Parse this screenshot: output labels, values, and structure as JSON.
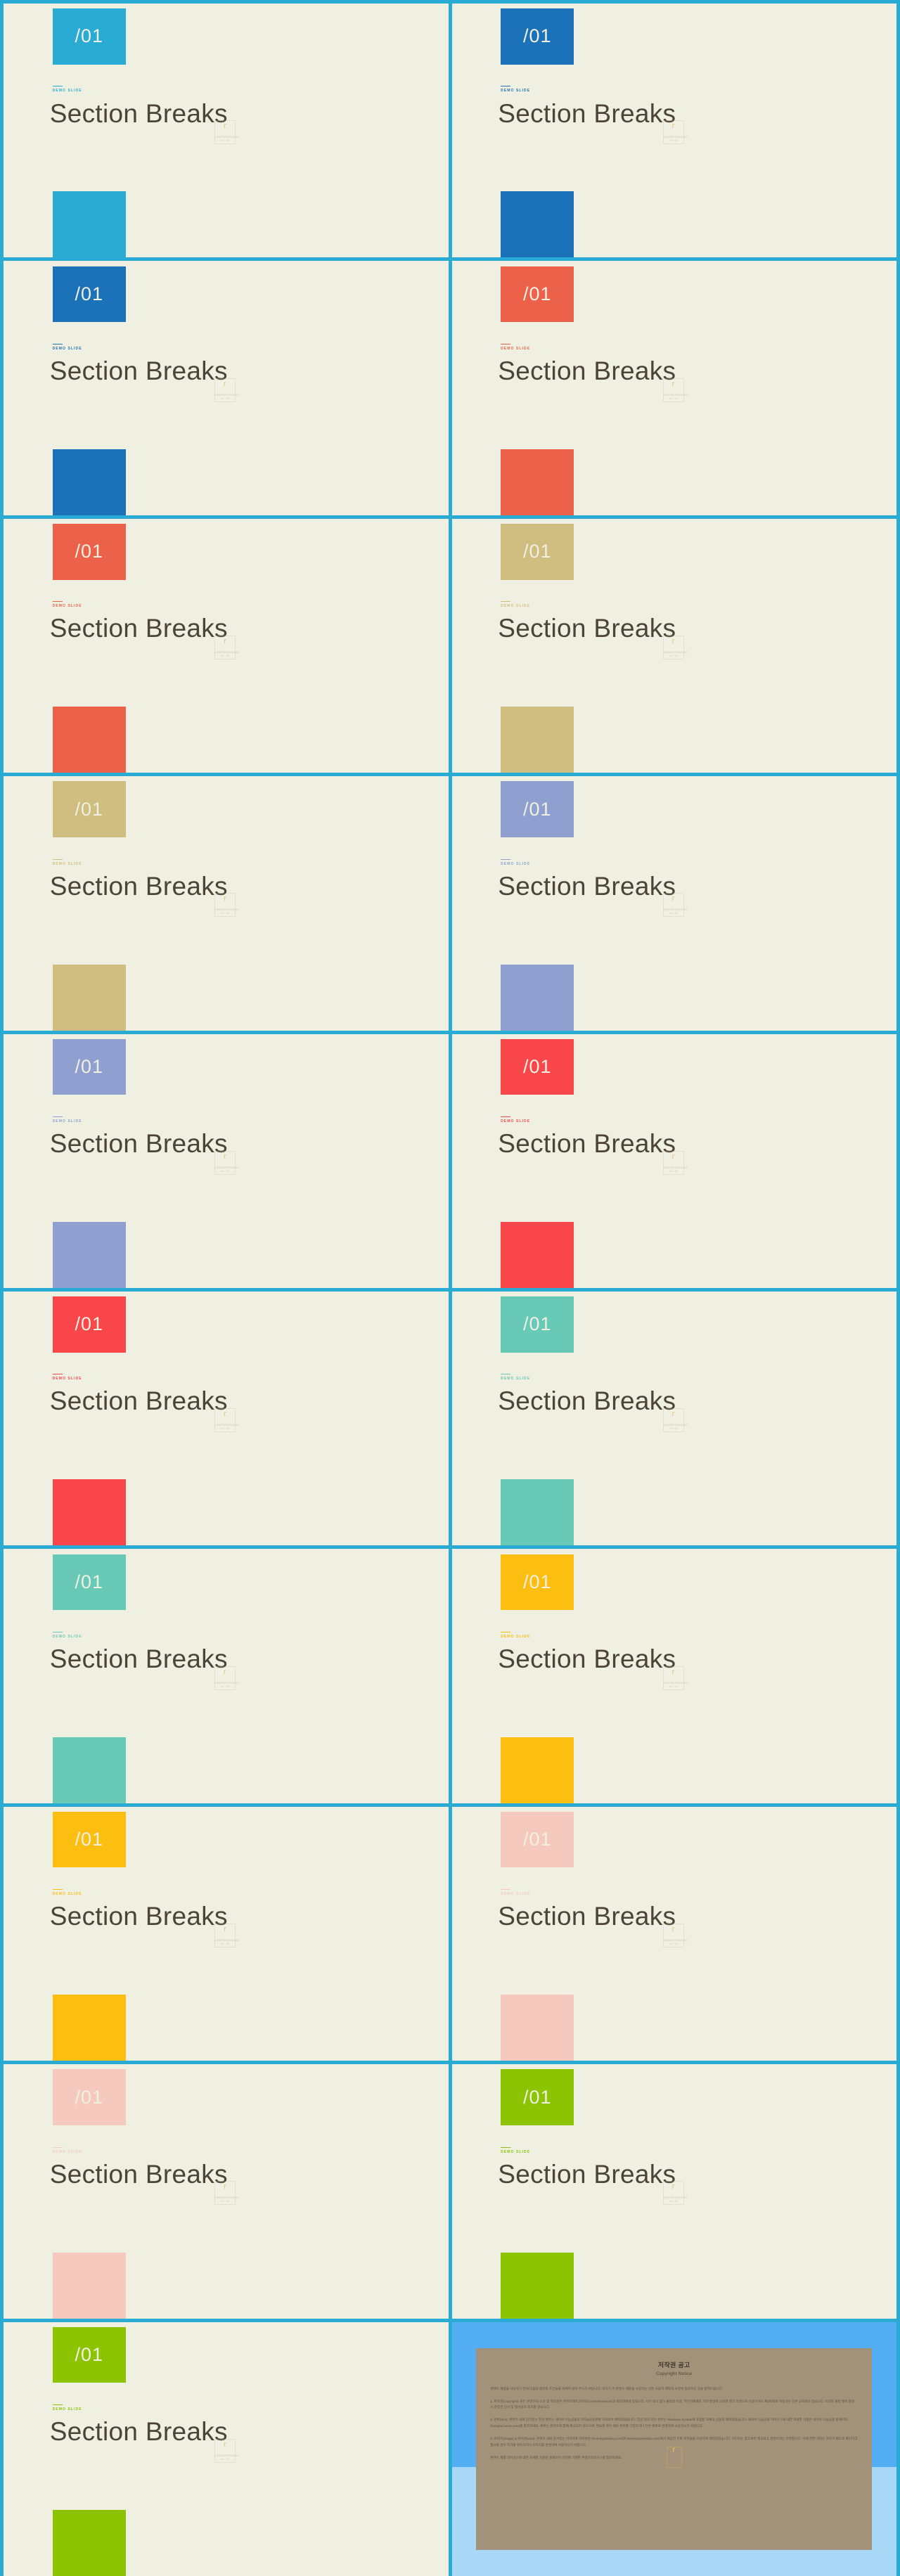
{
  "meta": {
    "canvas_background": "#29ABD4",
    "slide_background": "#EFF0E1",
    "title_color": "#4C4537",
    "divider_color": "#29ABD4"
  },
  "watermark": {
    "glyph": "⸢",
    "line1": "CONTENTSTAKEOUT",
    "line2": "PPT · 제작"
  },
  "slides": [
    {
      "number": "/01",
      "kicker": "DEMO SLIDE",
      "title": "Section Breaks",
      "accent": "#29ABD4"
    },
    {
      "number": "/01",
      "kicker": "DEMO SLIDE",
      "title": "Section Breaks",
      "accent": "#1C72B8"
    },
    {
      "number": "/01",
      "kicker": "DEMO SLIDE",
      "title": "Section Breaks",
      "accent": "#1C72B8"
    },
    {
      "number": "/01",
      "kicker": "DEMO SLIDE",
      "title": "Section Breaks",
      "accent": "#EC6149"
    },
    {
      "number": "/01",
      "kicker": "DEMO SLIDE",
      "title": "Section Breaks",
      "accent": "#EC6149"
    },
    {
      "number": "/01",
      "kicker": "DEMO SLIDE",
      "title": "Section Breaks",
      "accent": "#CFBE7F"
    },
    {
      "number": "/01",
      "kicker": "DEMO SLIDE",
      "title": "Section Breaks",
      "accent": "#CFBE7F"
    },
    {
      "number": "/01",
      "kicker": "DEMO SLIDE",
      "title": "Section Breaks",
      "accent": "#8FA0D0"
    },
    {
      "number": "/01",
      "kicker": "DEMO SLIDE",
      "title": "Section Breaks",
      "accent": "#8FA0D0"
    },
    {
      "number": "/01",
      "kicker": "DEMO SLIDE",
      "title": "Section Breaks",
      "accent": "#F9464B"
    },
    {
      "number": "/01",
      "kicker": "DEMO SLIDE",
      "title": "Section Breaks",
      "accent": "#F9464B"
    },
    {
      "number": "/01",
      "kicker": "DEMO SLIDE",
      "title": "Section Breaks",
      "accent": "#68C9B6"
    },
    {
      "number": "/01",
      "kicker": "DEMO SLIDE",
      "title": "Section Breaks",
      "accent": "#68C9B6"
    },
    {
      "number": "/01",
      "kicker": "DEMO SLIDE",
      "title": "Section Breaks",
      "accent": "#FCBE10"
    },
    {
      "number": "/01",
      "kicker": "DEMO SLIDE",
      "title": "Section Breaks",
      "accent": "#FCBE10"
    },
    {
      "number": "/01",
      "kicker": "DEMO SLIDE",
      "title": "Section Breaks",
      "accent": "#F5C9BE"
    },
    {
      "number": "/01",
      "kicker": "DEMO SLIDE",
      "title": "Section Breaks",
      "accent": "#F5C9BE"
    },
    {
      "number": "/01",
      "kicker": "DEMO SLIDE",
      "title": "Section Breaks",
      "accent": "#8CC404"
    },
    {
      "number": "/01",
      "kicker": "DEMO SLIDE",
      "title": "Section Breaks",
      "accent": "#8CC404"
    }
  ],
  "copyright": {
    "title_kr": "저작권 공고",
    "title_en": "Copyright Notice",
    "card_background": "#A2927A",
    "slide_background_top": "#53AEF2",
    "slide_background_bottom": "#A9D8F7",
    "paragraphs": [
      "콘텐츠 제품을 사용하기 전에 다음의 합의와 조건들을 자세히 읽어 주시기 바랍니다. 귀하가 이 콘텐츠 제품을 사용하는 것은 사용자 계약과 보증에 동의하신 것을 알려드립니다.",
      "1. 저작권(copyright): 모든 콘텐츠의 소유 및 저작권은 콘텐츠테이크아웃(Contentstakeout)과 제작자에게 있습니다. 사전 승낙 없이 불법적 이용, 무단전재배포 기타 법령에 의하여 영리 목적으로 이용하거나 제3자에게 이용하는 것은 금지되어 있습니다. 이러한 불법 행위 발견 시 준엄한 민사 및 형사상의 조치를 받습니다.",
      "2. 폰트(font): 콘텐츠 내에 담기있는 한글 폰트는 네이버 나눔글꼴의 저작&사용권에 귀속되어 제작되었습니다. 한글 외의 모든 폰트는 Windows System에 포함된 자체의 글꼴로 제작되었습니다. 네이버 나눔글꼴 라이선스에 대한 자세한 사항은 네이버 나눔글꼴 홈페이지(hangeul.naver.com)를 참조하세요. 폰트는 콘텐츠와 함께 제공되지 않으므로, 필요할 경우 해당 폰트를 구입하거나 다른 폰트로 변경하여 사용하시기 바랍니다.",
      "3. 이미지(image) & 아이콘(icon): 콘텐츠 내에 담겨있는 이미지와 아이콘은 Pixabay(pixabay.com)와 Webalys(webalys.com)에서 제공한 무료 저작물을 이용하여 제작되었습니다. 이미지는 참고로만 제공되고 콘텐츠와는 무관합니다. 이에 관한 저작는 귀하가 별도로 확인하고 필요할 경우 허가를 위득하거나 이미지를 변경하여 사용하시기 바랍니다.",
      "콘텐츠 제품 라이선스에 대한 자세한 사항은 홈페이지 하단에 기재한 콘텐츠라이선스를 참조하세요."
    ]
  }
}
